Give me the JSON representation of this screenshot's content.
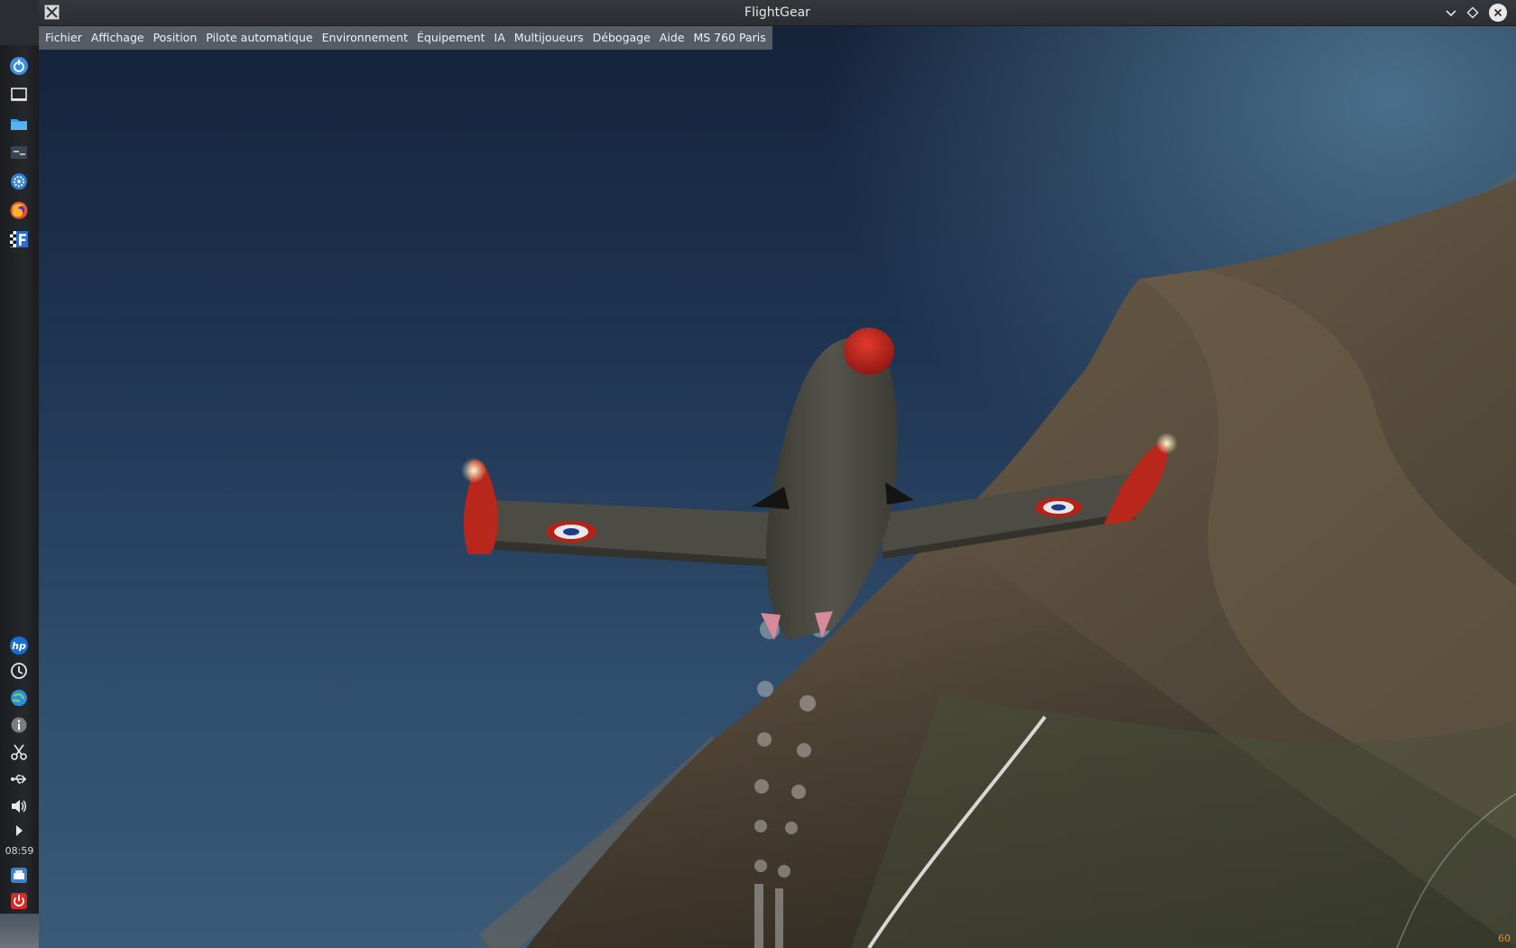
{
  "window": {
    "title": "FlightGear",
    "app_icon": "x-window-icon"
  },
  "menubar": {
    "items": [
      "Fichier",
      "Affichage",
      "Position",
      "Pilote automatique",
      "Environnement",
      "Équipement",
      "IA",
      "Multijoueurs",
      "Débogage",
      "Aide",
      "MS 760 Paris"
    ]
  },
  "taskbar": {
    "clock": "08:59",
    "top_icons": [
      "app-launcher-icon",
      "show-desktop-icon",
      "file-manager-icon",
      "system-settings-icon",
      "settings-gear-icon",
      "firefox-icon",
      "flightgear-icon"
    ],
    "bottom_icons": [
      "hp-icon",
      "updates-icon",
      "network-globe-icon",
      "info-icon",
      "scissors-icon",
      "usb-icon",
      "volume-icon",
      "expand-arrow-icon"
    ],
    "tray_icons": [
      "printer-icon",
      "power-icon"
    ]
  },
  "viewport": {
    "fps": "60"
  },
  "colors": {
    "sky_top": "#15233a",
    "sky_bottom": "#3a5a78",
    "terrain": "#5a4c3a",
    "aircraft_body": "#4b4a42",
    "aircraft_accent": "#c0241c",
    "fps_text": "#d98c3a"
  }
}
